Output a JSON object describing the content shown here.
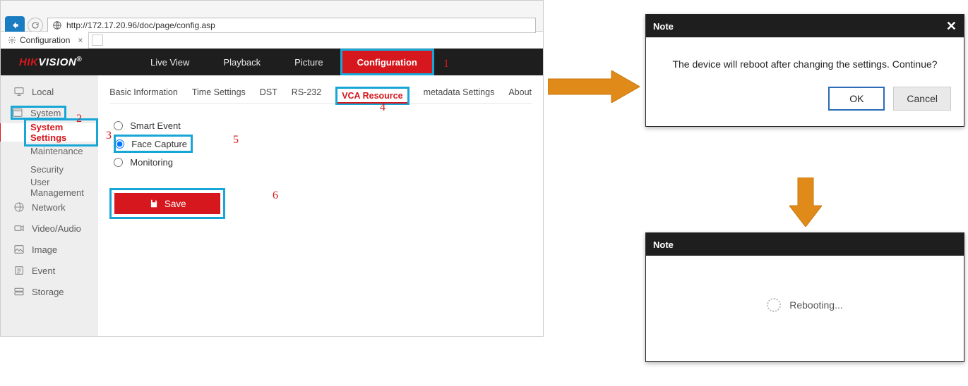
{
  "browser": {
    "url": "http://172.17.20.96/doc/page/config.asp",
    "tab_title": "Configuration"
  },
  "brand": {
    "hik": "HIK",
    "vision": "VISION",
    "reg": "®"
  },
  "topnav": {
    "items": [
      {
        "label": "Live View"
      },
      {
        "label": "Playback"
      },
      {
        "label": "Picture"
      },
      {
        "label": "Configuration",
        "active": true
      }
    ]
  },
  "sidebar": {
    "items": [
      {
        "label": "Local"
      },
      {
        "label": "System",
        "highlight": true
      },
      {
        "label": "Network"
      },
      {
        "label": "Video/Audio"
      },
      {
        "label": "Image"
      },
      {
        "label": "Event"
      },
      {
        "label": "Storage"
      }
    ],
    "system_sub": [
      {
        "label": "System Settings",
        "active": true
      },
      {
        "label": "Maintenance"
      },
      {
        "label": "Security"
      },
      {
        "label": "User Management"
      }
    ]
  },
  "subtabs": [
    {
      "label": "Basic Information"
    },
    {
      "label": "Time Settings"
    },
    {
      "label": "DST"
    },
    {
      "label": "RS-232"
    },
    {
      "label": "VCA Resource",
      "active": true
    },
    {
      "label": "metadata Settings"
    },
    {
      "label": "About"
    }
  ],
  "radios": [
    {
      "label": "Smart Event",
      "checked": false
    },
    {
      "label": "Face Capture",
      "checked": true
    },
    {
      "label": "Monitoring",
      "checked": false
    }
  ],
  "save_label": "Save",
  "annotations": {
    "a1": "1",
    "a2": "2",
    "a3": "3",
    "a4": "4",
    "a5": "5",
    "a6": "6"
  },
  "dialog1": {
    "title": "Note",
    "message": "The device will reboot after changing the settings. Continue?",
    "ok": "OK",
    "cancel": "Cancel"
  },
  "dialog2": {
    "title": "Note",
    "message": "Rebooting..."
  }
}
